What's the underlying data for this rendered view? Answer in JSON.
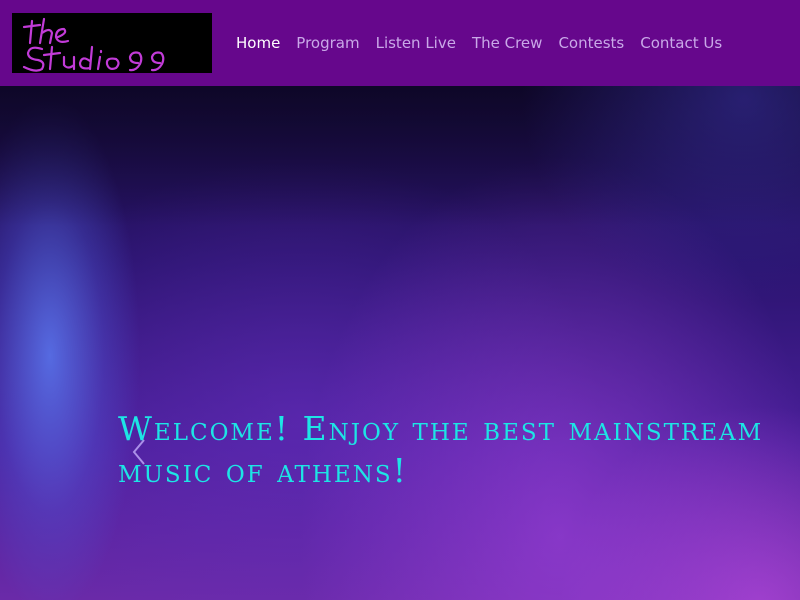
{
  "brand": {
    "logo_text": "the Studio99",
    "colors": {
      "nav_bg": "#66078c",
      "caption": "#1de5e5",
      "logo_stroke": "#c23bd8"
    }
  },
  "nav": {
    "items": [
      {
        "label": "Home",
        "active": true
      },
      {
        "label": "Program",
        "active": false
      },
      {
        "label": "Listen Live",
        "active": false
      },
      {
        "label": "The Crew",
        "active": false
      },
      {
        "label": "Contests",
        "active": false
      },
      {
        "label": "Contact Us",
        "active": false
      }
    ]
  },
  "hero": {
    "caption": "Welcome! Enjoy the best mainstream music of athens!",
    "prev_icon": "chevron-left-icon"
  }
}
